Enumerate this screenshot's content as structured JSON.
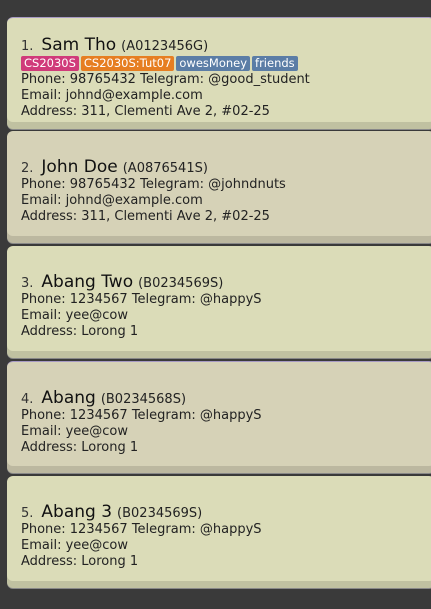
{
  "persons": [
    {
      "index": "1.",
      "name": "Sam Tho",
      "matric": "(A0123456G)",
      "tags": [
        {
          "label": "CS2030S",
          "color": "#d03b7a"
        },
        {
          "label": "CS2030S:Tut07",
          "color": "#e67e22"
        },
        {
          "label": "owesMoney",
          "color": "#5b7da6"
        },
        {
          "label": "friends",
          "color": "#5b7da6"
        }
      ],
      "phone": "Phone: 98765432",
      "telegram": "Telegram: @good_student",
      "email": "Email: johnd@example.com",
      "address": "Address: 311, Clementi Ave 2, #02-25"
    },
    {
      "index": "2.",
      "name": "John Doe",
      "matric": "(A0876541S)",
      "tags": [],
      "phone": "Phone: 98765432",
      "telegram": "Telegram: @johndnuts",
      "email": "Email: johnd@example.com",
      "address": "Address: 311, Clementi Ave 2, #02-25"
    },
    {
      "index": "3.",
      "name": "Abang Two",
      "matric": "(B0234569S)",
      "tags": [],
      "phone": "Phone: 1234567",
      "telegram": "Telegram: @happyS",
      "email": "Email: yee@cow",
      "address": "Address: Lorong 1"
    },
    {
      "index": "4.",
      "name": "Abang",
      "matric": "(B0234568S)",
      "tags": [],
      "phone": "Phone: 1234567",
      "telegram": "Telegram: @happyS",
      "email": "Email: yee@cow",
      "address": "Address: Lorong 1"
    },
    {
      "index": "5.",
      "name": "Abang 3",
      "matric": "(B0234569S)",
      "tags": [],
      "phone": "Phone: 1234567",
      "telegram": "Telegram: @happyS",
      "email": "Email: yee@cow",
      "address": "Address: Lorong 1"
    }
  ]
}
